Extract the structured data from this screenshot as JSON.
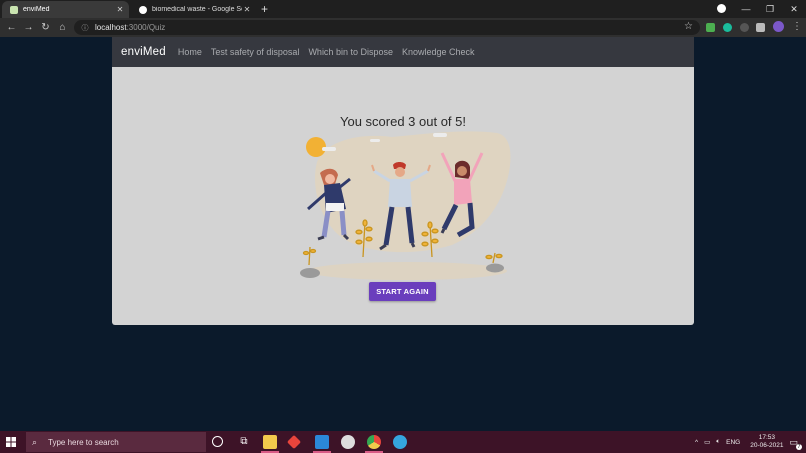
{
  "browser": {
    "tabs": [
      {
        "title": "enviMed",
        "active": true
      },
      {
        "title": "biomedical waste - Google Search",
        "active": false
      }
    ],
    "url_host": "localhost",
    "url_path": ":3000/Quiz"
  },
  "navbar": {
    "brand": "enviMed",
    "links": [
      "Home",
      "Test safety of disposal",
      "Which bin to Dispose",
      "Knowledge Check"
    ]
  },
  "quiz": {
    "result_text": "You scored 3 out of 5!",
    "restart_button": "START AGAIN"
  },
  "taskbar": {
    "search_placeholder": "Type here to search",
    "language": "ENG",
    "time": "17:53",
    "date": "20-06-2021",
    "notification_count": "7"
  },
  "colors": {
    "page_background": "#0b1a2b",
    "navbar": "#36383f",
    "card": "#d3d3d3",
    "button": "#6a3ebd",
    "taskbar": "#3d1327"
  }
}
